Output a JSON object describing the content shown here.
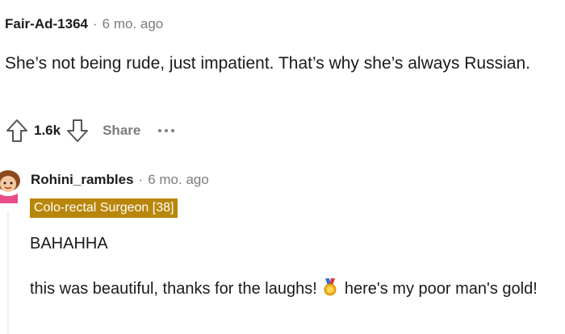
{
  "comment1": {
    "username": "Fair-Ad-1364",
    "separator": "·",
    "time": "6 mo. ago",
    "body": "She’s not being rude, just impatient. That’s why she’s always Russian.",
    "actions": {
      "upvote_icon": "upvote-arrow-icon",
      "score": "1.6k",
      "downvote_icon": "downvote-arrow-icon",
      "share_label": "Share",
      "more_icon": "more-dots-icon"
    }
  },
  "comment2": {
    "username": "Rohini_rambles",
    "separator": "·",
    "time": "6 mo. ago",
    "flair": "Colo-rectal Surgeon [38]",
    "paragraph1": "BAHAHHA",
    "paragraph2_before": "this was beautiful, thanks for the laughs!",
    "medal_icon": "gold-medal-icon",
    "paragraph2_after": "here's my poor man's gold!"
  },
  "colors": {
    "meta_gray": "#7c7c7c",
    "flair_bg": "#b8860b",
    "thread_line": "#edeff1"
  }
}
